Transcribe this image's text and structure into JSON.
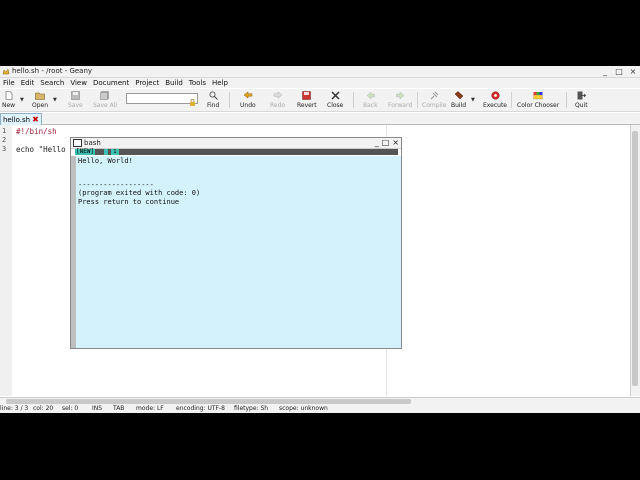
{
  "window": {
    "title": "hello.sh - /root - Geany",
    "minimize": "_",
    "maximize": "□",
    "close": "×"
  },
  "menu": [
    "File",
    "Edit",
    "Search",
    "View",
    "Document",
    "Project",
    "Build",
    "Tools",
    "Help"
  ],
  "toolbar": {
    "new": "New",
    "open": "Open",
    "save": "Save",
    "save_all": "Save All",
    "find": "Find",
    "undo": "Undo",
    "redo": "Redo",
    "revert": "Revert",
    "close": "Close",
    "back": "Back",
    "forward": "Forward",
    "compile": "Compile",
    "build": "Build",
    "execute": "Execute",
    "color_chooser": "Color Chooser",
    "quit": "Quit"
  },
  "tab": {
    "label": "hello.sh",
    "close": "✖"
  },
  "editor": {
    "line_numbers": [
      "1",
      "2",
      "3"
    ],
    "lines": [
      "#!/bin/sh",
      "",
      "echo \"Hello"
    ]
  },
  "terminal": {
    "title": "bash",
    "buttons": [
      "_",
      "□",
      "×"
    ],
    "status_new": "[NEW]",
    "status_mark": "1",
    "output": [
      "Hello, World!",
      "",
      "",
      "------------------",
      "(program exited with code: 0)",
      "Press return to continue"
    ]
  },
  "statusbar": {
    "line": "line: 3 / 3",
    "col": "col: 20",
    "sel": "sel: 0",
    "ins": "INS",
    "tab": "TAB",
    "mode": "mode: LF",
    "encoding": "encoding: UTF-8",
    "filetype": "filetype: Sh",
    "scope": "scope: unknown"
  },
  "colors": {
    "accent_tab": "#dff3ff",
    "terminal_bg": "#d4f2fc",
    "term_status": "#3bbfb0",
    "shebang": "#a0203a"
  }
}
